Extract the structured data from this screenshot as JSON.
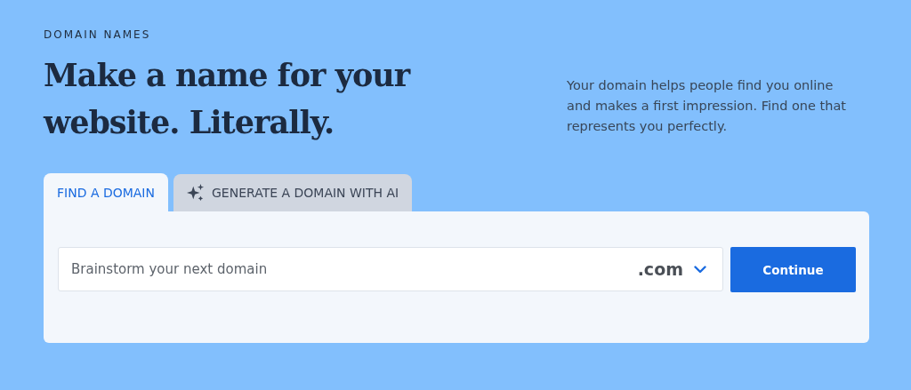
{
  "eyebrow": "DOMAIN NAMES",
  "headline": "Make a name for your website. Literally.",
  "intro": "Your domain helps people find you online and makes a first impression. Find one that represents you perfectly.",
  "tabs": [
    {
      "label": "FIND A DOMAIN",
      "selected": true,
      "kind": "plain"
    },
    {
      "label": "GENERATE A DOMAIN WITH AI",
      "selected": false,
      "kind": "ai"
    }
  ],
  "search": {
    "placeholder": "Brainstorm your next domain",
    "tld": ".com"
  },
  "buttons": [
    "Continue"
  ]
}
